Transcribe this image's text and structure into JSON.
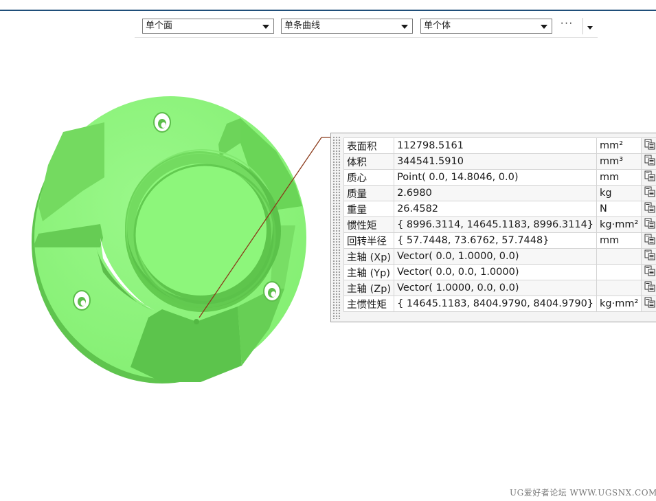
{
  "toolbar": {
    "face_filter": "单个面",
    "curve_filter": "单条曲线",
    "body_filter": "单个体",
    "more_label": "···"
  },
  "measure": {
    "rows": [
      {
        "name": "表面积",
        "value": "112798.5161",
        "unit": "mm²"
      },
      {
        "name": "体积",
        "value": "344541.5910",
        "unit": "mm³"
      },
      {
        "name": "质心",
        "value": "Point( 0.0, 14.8046, 0.0)",
        "unit": "mm"
      },
      {
        "name": "质量",
        "value": "2.6980",
        "unit": "kg"
      },
      {
        "name": "重量",
        "value": "26.4582",
        "unit": "N"
      },
      {
        "name": "惯性矩",
        "value": "{ 8996.3114, 14645.1183, 8996.3114}",
        "unit": "kg·mm²"
      },
      {
        "name": "回转半径",
        "value": "{ 57.7448, 73.6762, 57.7448}",
        "unit": "mm"
      },
      {
        "name": "主轴 (Xp)",
        "value": "Vector( 0.0, 1.0000, 0.0)",
        "unit": ""
      },
      {
        "name": "主轴 (Yp)",
        "value": "Vector( 0.0, 0.0, 1.0000)",
        "unit": ""
      },
      {
        "name": "主轴 (Zp)",
        "value": "Vector( 1.0000, 0.0, 0.0)",
        "unit": ""
      },
      {
        "name": "主惯性矩",
        "value": "{ 14645.1183, 8404.9790, 8404.9790}",
        "unit": "kg·mm²"
      }
    ],
    "row_icons": [
      "copy-to-clipboard-icon",
      "show-hide-eye-icon"
    ]
  },
  "watermark": "UG爱好者论坛 WWW.UGSNX.COM",
  "colors": {
    "model_green": "#8cf47c",
    "model_shadow": "#5fc44e",
    "leader_line": "#8b3a1a",
    "title_bar": "#1f4e79"
  }
}
